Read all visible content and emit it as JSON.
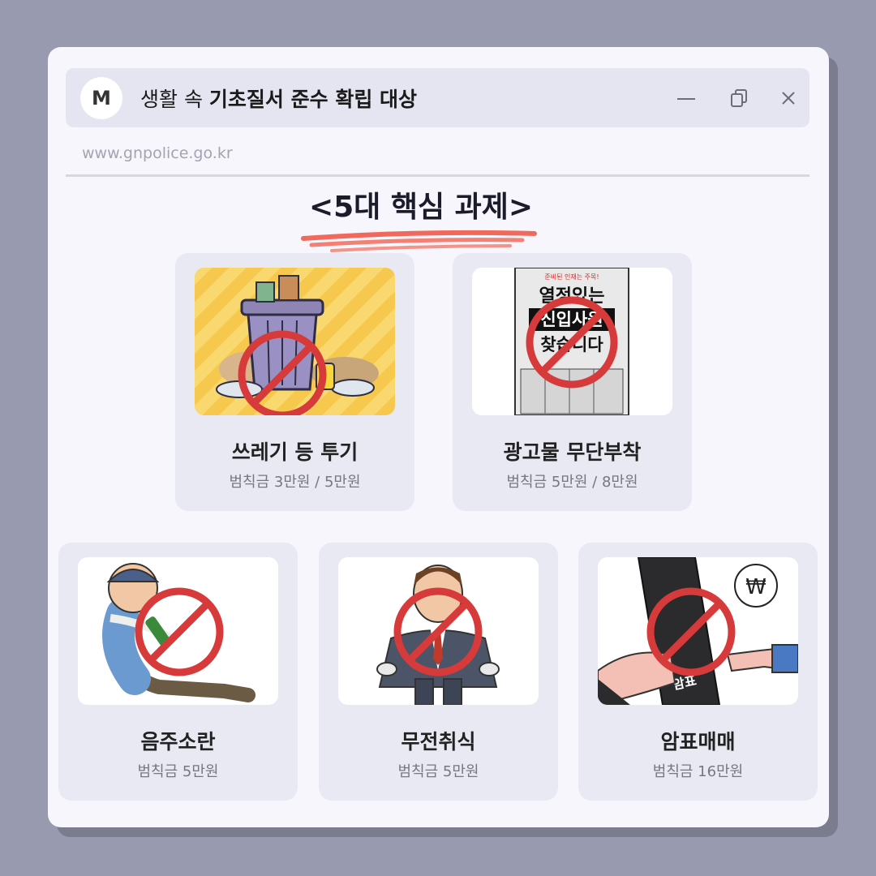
{
  "window": {
    "avatar_letter": "M",
    "title_prefix": "생활 속 ",
    "title_bold": "기초질서 준수 확립 대상",
    "url": "www.gnpolice.go.kr"
  },
  "heading": "<5대 핵심 과제>",
  "colors": {
    "accent": "#f15a4a",
    "card_bg": "#e8e9f3",
    "window_bg": "#f6f6fc"
  },
  "cards": [
    {
      "name": "쓰레기 등 투기",
      "fine": "범칙금 3만원 / 5만원",
      "icon": "trash-can-icon"
    },
    {
      "name": "광고물 무단부착",
      "fine": "범칙금 5만원 / 8만원",
      "icon": "poster-icon",
      "poster_text": [
        "준비된 인재는 주목!",
        "열정있는",
        "신입사원",
        "찾습니다"
      ]
    },
    {
      "name": "음주소란",
      "fine": "범칙금 5만원",
      "icon": "drunk-man-icon"
    },
    {
      "name": "무전취식",
      "fine": "범칙금 5만원",
      "icon": "empty-pockets-man-icon"
    },
    {
      "name": "암표매매",
      "fine": "범칙금 16만원",
      "icon": "ticket-scalping-icon",
      "ticket_text": "암표",
      "currency_symbol": "₩"
    }
  ]
}
